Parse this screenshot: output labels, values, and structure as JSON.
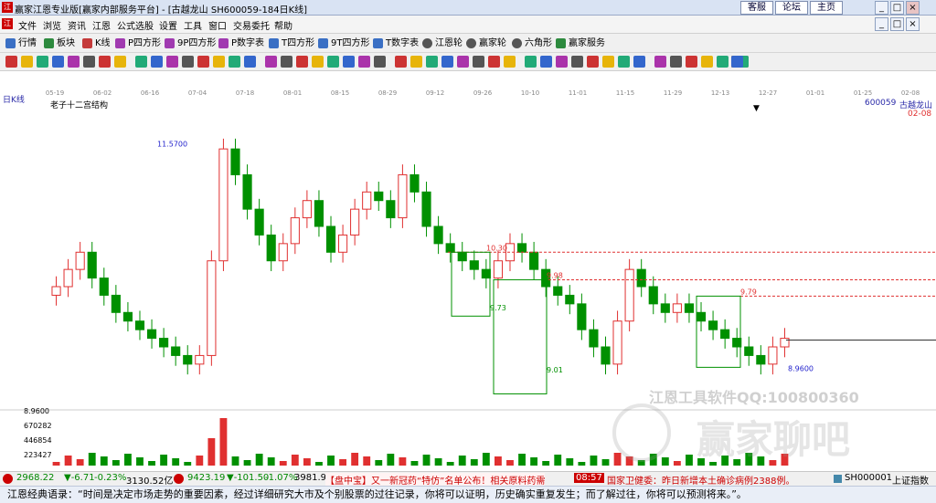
{
  "window": {
    "title": "赢家江恩专业版[赢家内部服务平台] - [古越龙山  SH600059-184日K线]",
    "logo": "江",
    "links": [
      "客服",
      "论坛",
      "主页"
    ],
    "controls": [
      "_",
      "□",
      "×"
    ],
    "mdi_controls": [
      "_",
      "□",
      "×"
    ]
  },
  "menu": {
    "logo": "江",
    "items": [
      "文件",
      "浏览",
      "资讯",
      "江恩",
      "公式选股",
      "设置",
      "工具",
      "窗口",
      "交易委托",
      "帮助"
    ]
  },
  "toolbar": {
    "items": [
      {
        "label": "行情",
        "color": "#3a6fc4"
      },
      {
        "label": "板块",
        "color": "#2d8a3e"
      },
      {
        "label": "K线",
        "color": "#c43a3a"
      },
      {
        "label": "P四方形",
        "color": "#a03ab0"
      },
      {
        "label": "9P四方形",
        "color": "#a03ab0"
      },
      {
        "label": "P数字表",
        "color": "#a03ab0"
      },
      {
        "label": "T四方形",
        "color": "#3a6fc4"
      },
      {
        "label": "9T四方形",
        "color": "#3a6fc4"
      },
      {
        "label": "T数字表",
        "color": "#3a6fc4"
      },
      {
        "label": "江恩轮",
        "color": "#555"
      },
      {
        "label": "赢家轮",
        "color": "#555"
      },
      {
        "label": "六角形",
        "color": "#555"
      },
      {
        "label": "赢家服务",
        "color": "#2d8a3e"
      }
    ]
  },
  "chart": {
    "period_label": "日K线",
    "structure_label": "老子十二宫结构",
    "stock_code": "600059",
    "stock_name": "古越龙山",
    "current_date": "02-08",
    "watermark_text": "江恩工具软件QQ:100800360",
    "watermark_logo_text": "赢家聊吧",
    "date_ticks": [
      "05-19",
      "06-02",
      "06-16",
      "07-04",
      "07-18",
      "08-01",
      "08-15",
      "08-29",
      "09-12",
      "09-26",
      "10-10",
      "11-01",
      "11-15",
      "11-29",
      "12-13",
      "12-27",
      "01-01",
      "01-25",
      "02-08"
    ],
    "price_annotations": [
      "11.5700",
      "8.9600",
      "10.30",
      "9.98",
      "9.79",
      "9.73",
      "9.01"
    ],
    "volume_ticks": [
      "8.9600",
      "670282",
      "446854",
      "223427"
    ],
    "colors": {
      "up": "#e03030",
      "down": "#009000",
      "box": "#009000",
      "resistance": "#e03030",
      "annotation": "#2222cc",
      "grid_dates": "#888888"
    }
  },
  "chart_data": {
    "type": "candlestick",
    "title": "古越龙山 600059 日K线",
    "ylim": [
      8.5,
      12.0
    ],
    "high_label": "11.5700",
    "low_label": "8.9600",
    "resistance_levels": [
      10.3,
      9.98,
      9.79
    ],
    "support_level": 9.01,
    "series_close_approx": [
      9.9,
      10.1,
      10.3,
      10.0,
      9.8,
      9.6,
      9.5,
      9.4,
      9.3,
      9.2,
      9.1,
      9.0,
      9.1,
      10.2,
      11.5,
      11.2,
      10.8,
      10.5,
      10.2,
      10.4,
      10.7,
      10.9,
      10.6,
      10.3,
      10.5,
      10.8,
      11.0,
      10.9,
      10.7,
      11.2,
      11.0,
      10.6,
      10.4,
      10.3,
      10.2,
      10.1,
      10.0,
      10.2,
      10.4,
      10.3,
      10.1,
      9.9,
      9.8,
      9.7,
      9.4,
      9.2,
      9.0,
      9.5,
      10.1,
      9.9,
      9.7,
      9.6,
      9.7,
      9.6,
      9.5,
      9.4,
      9.3,
      9.2,
      9.1,
      9.0,
      9.2,
      9.3
    ]
  },
  "status": {
    "index1": "2968.22",
    "index1_change": "▼-6.71",
    "index1_pct": "-0.23%",
    "index1_amount": "3130.52亿",
    "index2": "9423.19",
    "index2_change": "▼-101.50",
    "index2_pct": "-1.07%",
    "index2_amount": "3981.9",
    "news1": "【盘中宝】又一新冠药“特仿”名单公布！相关原料药需",
    "time": "08:57",
    "news2": "国家卫健委：昨日新增本土确诊病例2388例。",
    "index_code": "SH000001",
    "index_name": "上证指数"
  },
  "quote": {
    "text": "江恩经典语录：“时间是决定市场走势的重要因素，经过详细研究大市及个别股票的过往记录，你将可以证明，历史确实重复发生；而了解过往，你将可以预测将来。”。"
  }
}
